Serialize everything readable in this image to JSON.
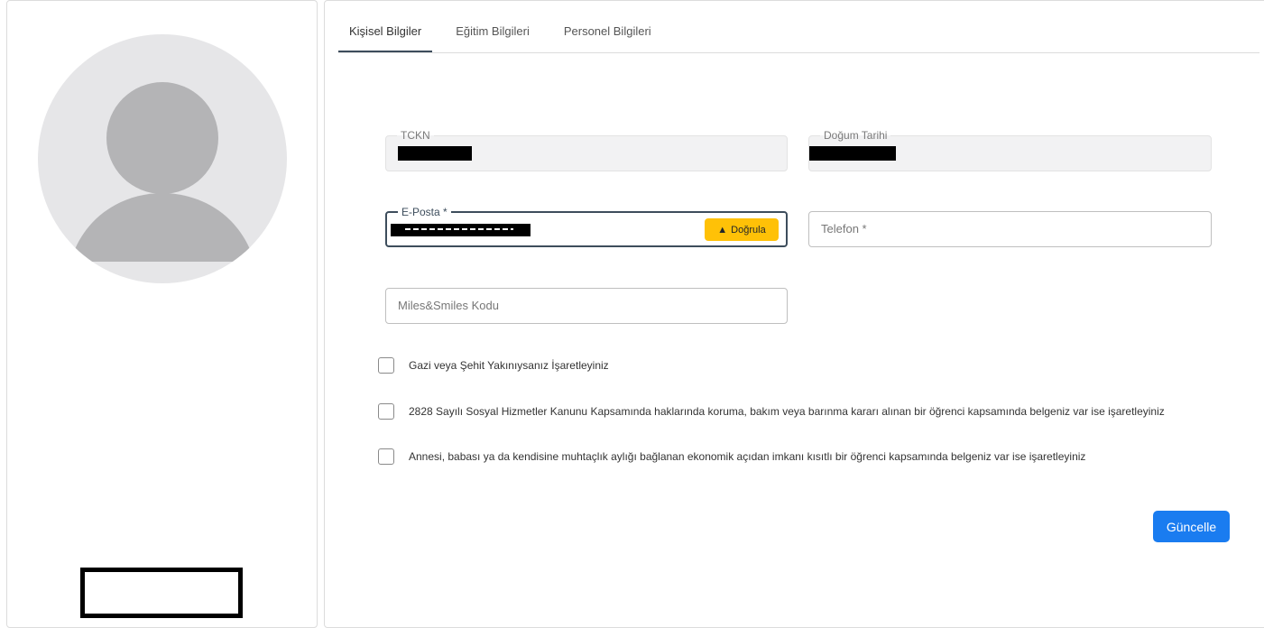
{
  "tabs": [
    {
      "label": "Kişisel Bilgiler",
      "active": true
    },
    {
      "label": "Eğitim Bilgileri",
      "active": false
    },
    {
      "label": "Personel Bilgileri",
      "active": false
    }
  ],
  "fields": {
    "tckn": {
      "label": "TCKN"
    },
    "birth_date": {
      "label": "Doğum Tarihi"
    },
    "email": {
      "label": "E-Posta *",
      "verify_label": "Doğrula"
    },
    "phone": {
      "placeholder": "Telefon *"
    },
    "miles": {
      "placeholder": "Miles&Smiles Kodu"
    }
  },
  "checkboxes": [
    {
      "label": "Gazi veya Şehit Yakınıysanız İşaretleyiniz",
      "checked": false
    },
    {
      "label": "2828 Sayılı Sosyal Hizmetler Kanunu Kapsamında haklarında koruma, bakım veya barınma kararı alınan bir öğrenci kapsamında belgeniz var ise işaretleyiniz",
      "checked": false
    },
    {
      "label": "Annesi, babası ya da kendisine muhtaçlık aylığı bağlanan ekonomik açıdan imkanı kısıtlı bir öğrenci kapsamında belgeniz var ise işaretleyiniz",
      "checked": false
    }
  ],
  "actions": {
    "update_label": "Güncelle"
  },
  "icons": {
    "avatar": "user-placeholder-icon",
    "verify": "warning-triangle-icon"
  },
  "colors": {
    "primary": "#1a7cf0",
    "warning": "#ffc107",
    "tab_active": "#3d4d5c"
  }
}
